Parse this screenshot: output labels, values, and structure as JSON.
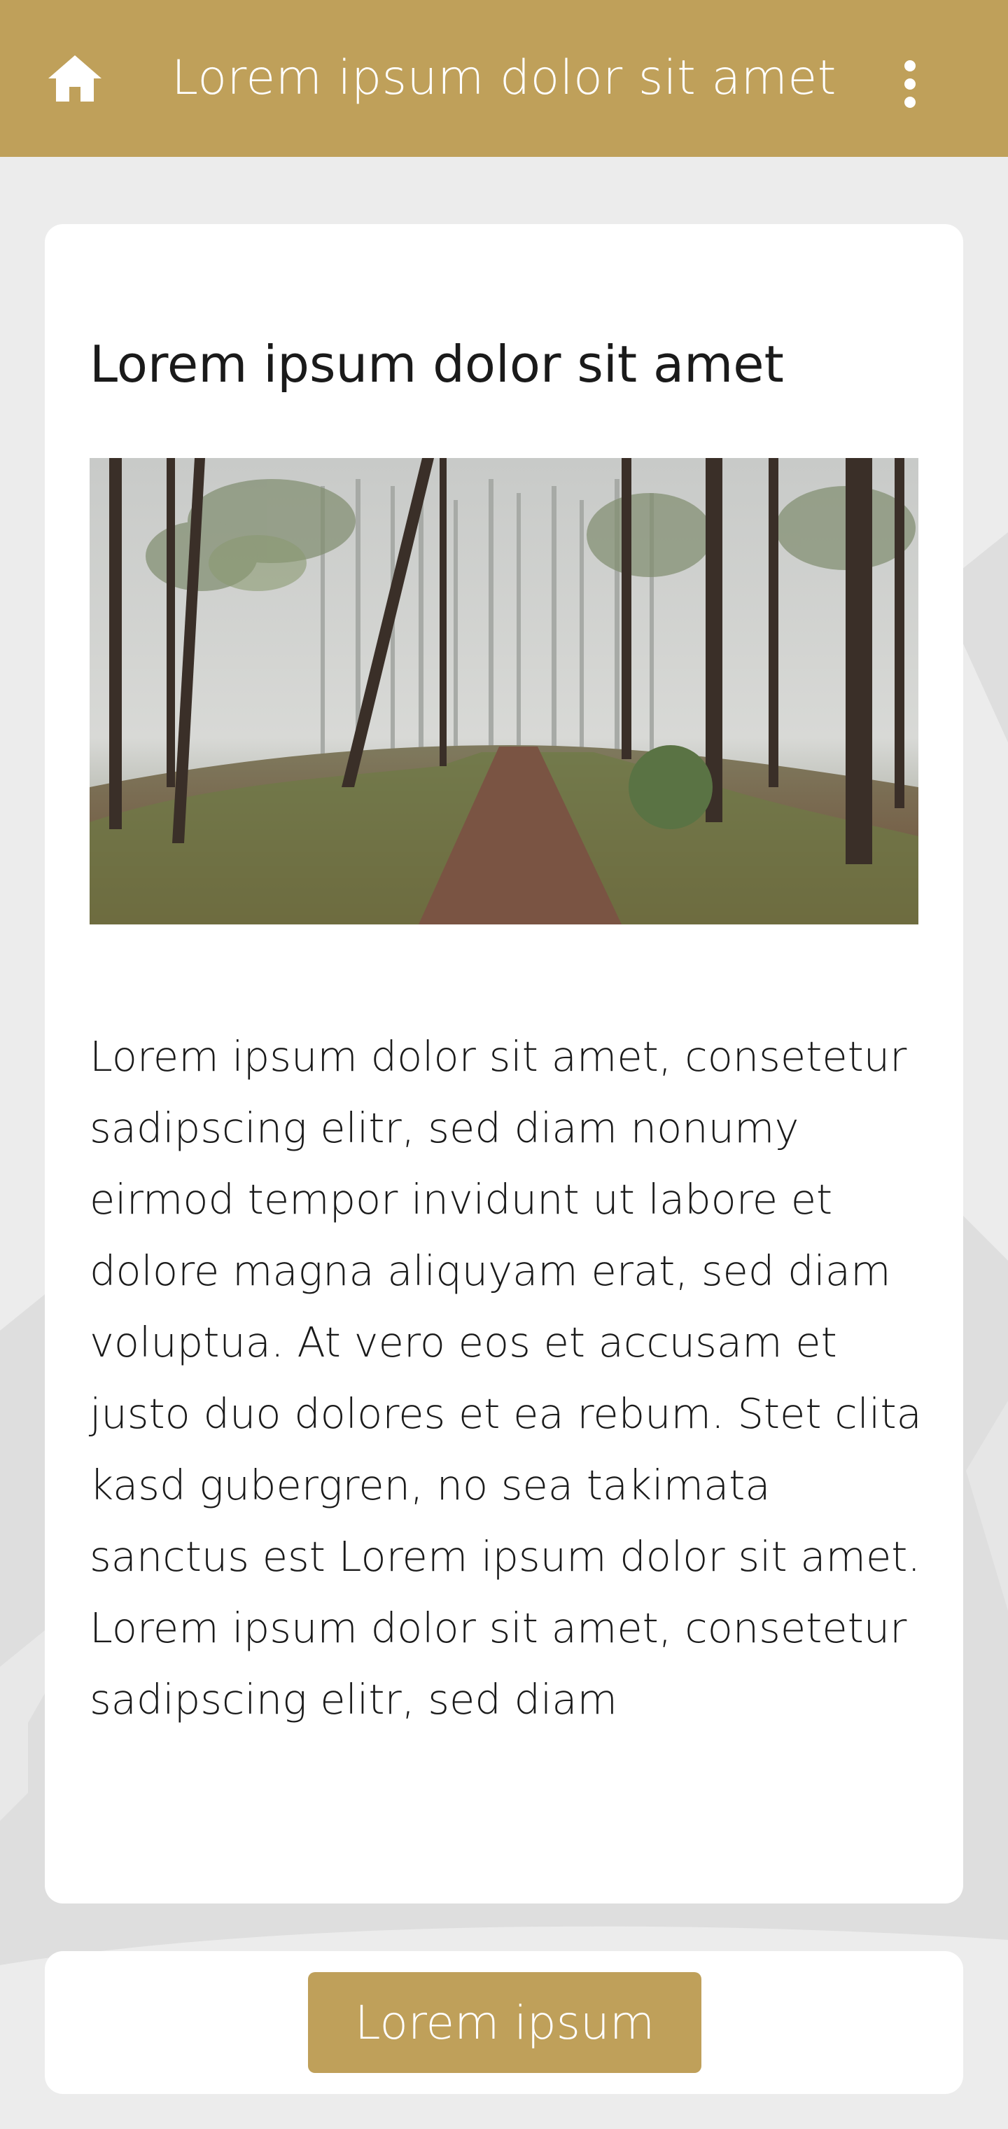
{
  "colors": {
    "accent": "#bfa05a",
    "background": "#ececec",
    "card": "#ffffff",
    "text": "#1a1a1a"
  },
  "app_bar": {
    "title": "Lorem ipsum dolor sit amet",
    "left_icon": "home-icon",
    "right_icon": "more-vertical-icon"
  },
  "article": {
    "title": "Lorem ipsum dolor sit amet",
    "image_subject": "forest-path-photo",
    "body": "Lorem ipsum dolor sit amet, consetetur sadipscing elitr, sed diam nonumy eirmod tempor invidunt ut labore et dolore magna aliquyam erat, sed diam voluptua. At vero eos et accusam et justo duo dolores et ea rebum. Stet clita kasd gubergren, no sea takimata sanctus est Lorem ipsum dolor sit amet. Lorem ipsum dolor sit amet, consetetur sadipscing elitr, sed diam"
  },
  "bottom_bar": {
    "button_label": "Lorem ipsum"
  }
}
